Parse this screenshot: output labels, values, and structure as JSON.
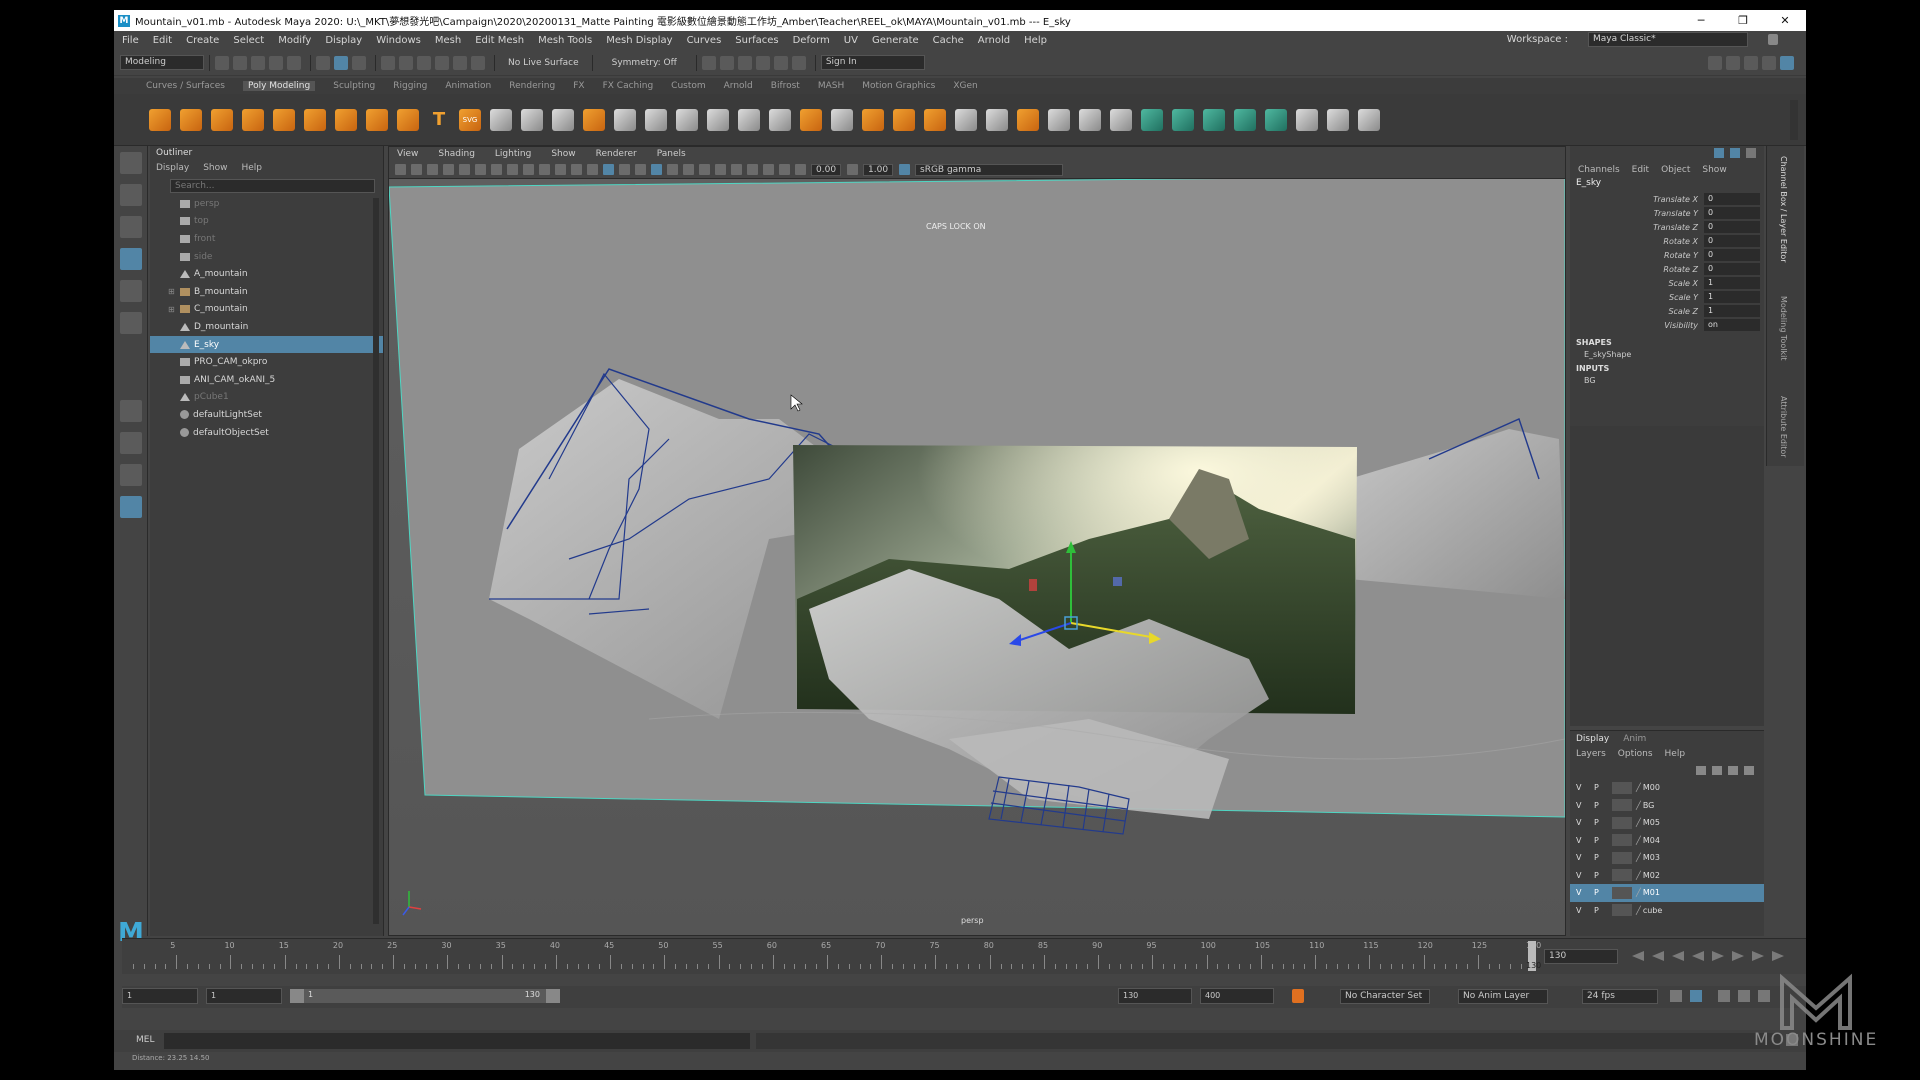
{
  "titlebar": {
    "title": "Mountain_v01.mb - Autodesk Maya 2020: U:\\_MKT\\夢想發光吧\\Campaign\\2020\\20200131_Matte Painting 電影級數位繪景動態工作坊_Amber\\Teacher\\REEL_ok\\MAYA\\Mountain_v01.mb  ---  E_sky",
    "logo": "M",
    "minimize": "─",
    "maximize": "❐",
    "close": "✕"
  },
  "menubar": {
    "items": [
      "File",
      "Edit",
      "Create",
      "Select",
      "Modify",
      "Display",
      "Windows",
      "Mesh",
      "Edit Mesh",
      "Mesh Tools",
      "Mesh Display",
      "Curves",
      "Surfaces",
      "Deform",
      "UV",
      "Generate",
      "Cache",
      "Arnold",
      "Help"
    ],
    "workspace_label": "Workspace :",
    "workspace_value": "Maya Classic*"
  },
  "statusline": {
    "mode": "Modeling",
    "live_surface": "No Live Surface",
    "symmetry": "Symmetry: Off",
    "sign_in": "Sign In"
  },
  "shelf": {
    "tabs": [
      "Curves / Surfaces",
      "Poly Modeling",
      "Sculpting",
      "Rigging",
      "Animation",
      "Rendering",
      "FX",
      "FX Caching",
      "Custom",
      "Arnold",
      "Bifrost",
      "MASH",
      "Motion Graphics",
      "XGen"
    ],
    "active_tab": "Poly Modeling",
    "text_icon": "T",
    "svg_icon": "SVG"
  },
  "outliner": {
    "title": "Outliner",
    "menu": [
      "Display",
      "Show",
      "Help"
    ],
    "search_placeholder": "Search...",
    "items": [
      {
        "label": "persp",
        "dim": true,
        "icon": "camera-icon"
      },
      {
        "label": "top",
        "dim": true,
        "icon": "camera-icon"
      },
      {
        "label": "front",
        "dim": true,
        "icon": "camera-icon"
      },
      {
        "label": "side",
        "dim": true,
        "icon": "camera-icon"
      },
      {
        "label": "A_mountain",
        "dim": false,
        "icon": "mesh-icon"
      },
      {
        "label": "B_mountain",
        "dim": false,
        "icon": "group-icon",
        "expand": true
      },
      {
        "label": "C_mountain",
        "dim": false,
        "icon": "group-icon",
        "expand": true
      },
      {
        "label": "D_mountain",
        "dim": false,
        "icon": "mesh-icon"
      },
      {
        "label": "E_sky",
        "dim": false,
        "icon": "mesh-icon",
        "selected": true
      },
      {
        "label": "PRO_CAM_okpro",
        "dim": false,
        "icon": "camera-icon"
      },
      {
        "label": "ANI_CAM_okANI_5",
        "dim": false,
        "icon": "camera-icon"
      },
      {
        "label": "pCube1",
        "dim": true,
        "icon": "mesh-icon"
      },
      {
        "label": "defaultLightSet",
        "dim": false,
        "icon": "set-icon"
      },
      {
        "label": "defaultObjectSet",
        "dim": false,
        "icon": "set-icon"
      }
    ]
  },
  "viewport": {
    "menu": [
      "View",
      "Shading",
      "Lighting",
      "Show",
      "Renderer",
      "Panels"
    ],
    "exposure": "0.00",
    "gamma": "1.00",
    "colorspace": "sRGB gamma",
    "caps_lock": "CAPS LOCK ON",
    "camera_label": "persp"
  },
  "channelbox": {
    "menu": [
      "Channels",
      "Edit",
      "Object",
      "Show"
    ],
    "object": "E_sky",
    "attributes": [
      {
        "name": "Translate X",
        "value": "0"
      },
      {
        "name": "Translate Y",
        "value": "0"
      },
      {
        "name": "Translate Z",
        "value": "0"
      },
      {
        "name": "Rotate X",
        "value": "0"
      },
      {
        "name": "Rotate Y",
        "value": "0"
      },
      {
        "name": "Rotate Z",
        "value": "0"
      },
      {
        "name": "Scale X",
        "value": "1"
      },
      {
        "name": "Scale Y",
        "value": "1"
      },
      {
        "name": "Scale Z",
        "value": "1"
      },
      {
        "name": "Visibility",
        "value": "on"
      }
    ],
    "shapes_label": "SHAPES",
    "shape": "E_skyShape",
    "inputs_label": "INPUTS",
    "input": "BG",
    "side_tabs": [
      "Channel Box / Layer Editor",
      "Modeling Toolkit",
      "Attribute Editor"
    ]
  },
  "layereditor": {
    "tabs": [
      "Display",
      "Anim"
    ],
    "active_tab": "Display",
    "menu": [
      "Layers",
      "Options",
      "Help"
    ],
    "layers": [
      {
        "v": "V",
        "p": "P",
        "name": "M00"
      },
      {
        "v": "V",
        "p": "P",
        "name": "BG"
      },
      {
        "v": "V",
        "p": "P",
        "name": "M05"
      },
      {
        "v": "V",
        "p": "P",
        "name": "M04"
      },
      {
        "v": "V",
        "p": "P",
        "name": "M03"
      },
      {
        "v": "V",
        "p": "P",
        "name": "M02"
      },
      {
        "v": "V",
        "p": "P",
        "name": "M01",
        "selected": true
      },
      {
        "v": "V",
        "p": "P",
        "name": "cube"
      }
    ]
  },
  "timeslider": {
    "ticks": [
      "5",
      "10",
      "15",
      "20",
      "25",
      "30",
      "35",
      "40",
      "45",
      "50",
      "55",
      "60",
      "65",
      "70",
      "75",
      "80",
      "85",
      "90",
      "95",
      "100",
      "105",
      "110",
      "115",
      "120",
      "125",
      "130"
    ],
    "current_frame": "130",
    "current_field": "130"
  },
  "rangeslider": {
    "start": "1",
    "playback_start": "1",
    "range_start": "1",
    "range_end": "130",
    "playback_end": "130",
    "end": "400",
    "character_set": "No Character Set",
    "anim_layer": "No Anim Layer",
    "fps": "24 fps"
  },
  "mel": {
    "label": "MEL"
  },
  "helpline": {
    "text": "Distance: 23.25    14.50"
  },
  "watermark": {
    "text": "MOONSHINE"
  }
}
